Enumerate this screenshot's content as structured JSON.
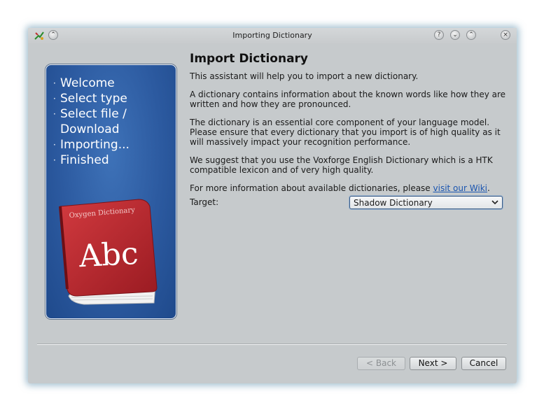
{
  "window": {
    "title": "Importing Dictionary",
    "buttons": {
      "help": "?",
      "minimize": "⌄",
      "maximize": "⌃",
      "close": "×",
      "shade": "⌃"
    }
  },
  "sidebar": {
    "steps": [
      {
        "label": "Welcome"
      },
      {
        "label": "Select type"
      },
      {
        "label": "Select file /"
      },
      {
        "label": "Download",
        "continuation": true
      },
      {
        "label": "Importing..."
      },
      {
        "label": "Finished"
      }
    ],
    "book": {
      "title": "Oxygen Dictionary",
      "cover_text": "Abc"
    }
  },
  "main": {
    "heading": "Import Dictionary",
    "paragraphs": [
      "This assistant will help you to import a new dictionary.",
      "A dictionary contains information about the known words like how they are written and how they are pronounced.",
      "The dictionary is an essential core component of your language model. Please ensure that every dictionary that you import is of high quality as it will massively impact your recognition performance.",
      "We suggest that you use the Voxforge English Dictionary which is a HTK compatible lexicon and of very high quality."
    ],
    "more_info_prefix": "For more information about available dictionaries, please ",
    "more_info_link": "visit our Wiki",
    "more_info_suffix": ".",
    "target_label": "Target:",
    "target_value": "Shadow Dictionary"
  },
  "footer": {
    "back_label": "< Back",
    "next_label": "Next >",
    "cancel_label": "Cancel"
  },
  "colors": {
    "sidebar_blue": "#2c5aa0",
    "window_bg": "#c6cacc",
    "book_red": "#b8232a",
    "link": "#1a55b0"
  }
}
